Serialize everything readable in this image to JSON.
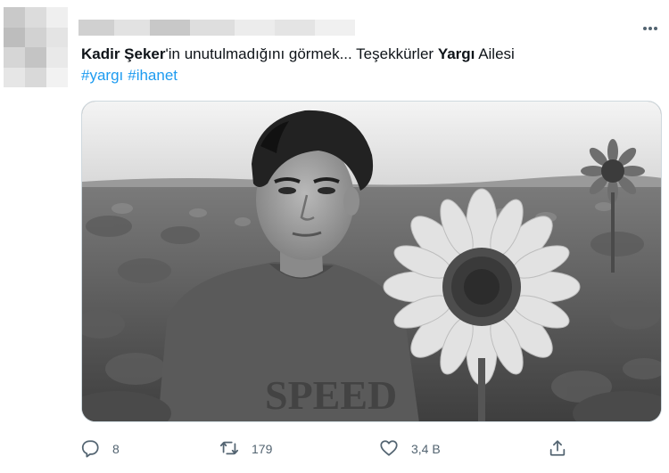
{
  "tweet": {
    "text": {
      "mention_bold": "Kadir Şeker",
      "part1": "'in unutulmadığını görmek... Teşekkürler ",
      "show_bold": "Yargı",
      "part2": " Ailesi"
    },
    "hashtags": [
      "#yargı",
      "#ihanet"
    ],
    "icons": {
      "more": "more-options-icon",
      "reply": "reply-icon",
      "retweet": "retweet-icon",
      "like": "like-icon",
      "share": "share-icon"
    }
  },
  "actions": {
    "reply_count": "8",
    "retweet_count": "179",
    "like_count": "3,4 B"
  },
  "colors": {
    "accent": "#1d9bf0",
    "icon_gray": "#536471",
    "text": "#0f1419",
    "border": "#cfd9de"
  }
}
